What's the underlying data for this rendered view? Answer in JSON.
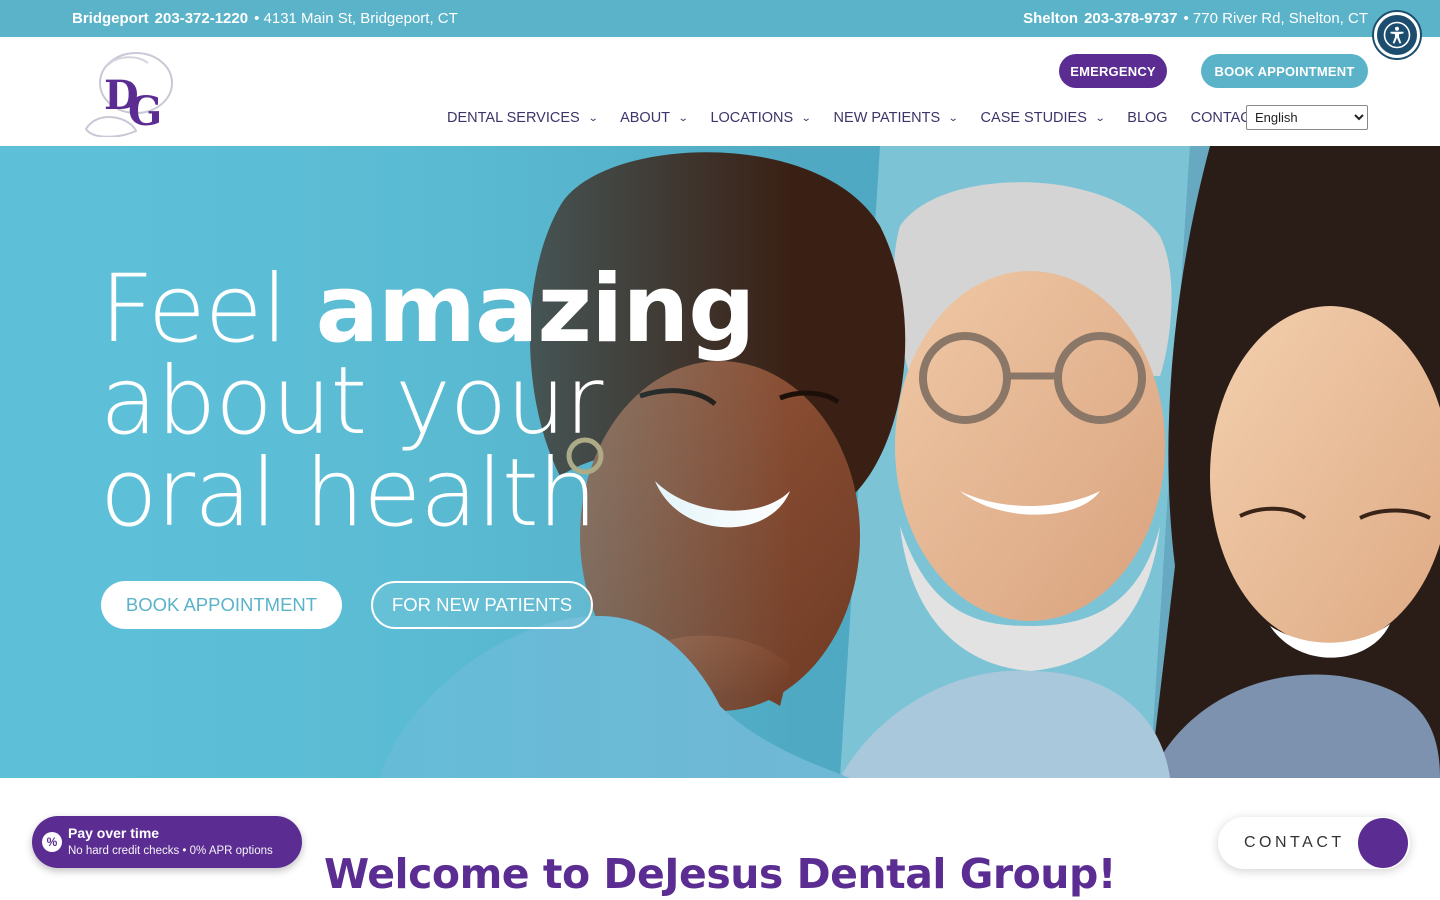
{
  "topbar": {
    "left": {
      "city": "Bridgeport",
      "phone": "203-372-1220",
      "address": "• 4131 Main St, Bridgeport, CT"
    },
    "right": {
      "city": "Shelton",
      "phone": "203-378-9737",
      "address": "• 770 River Rd, Shelton, CT"
    }
  },
  "accessibility": {
    "icon": "accessibility-icon"
  },
  "logo": {
    "text": "DG"
  },
  "header": {
    "emergency_label": "EMERGENCY",
    "book_label": "BOOK APPOINTMENT"
  },
  "nav": {
    "items": [
      {
        "label": "DENTAL SERVICES",
        "has_dropdown": true
      },
      {
        "label": "ABOUT",
        "has_dropdown": true
      },
      {
        "label": "LOCATIONS",
        "has_dropdown": true
      },
      {
        "label": "NEW PATIENTS",
        "has_dropdown": true
      },
      {
        "label": "CASE STUDIES",
        "has_dropdown": true
      },
      {
        "label": "BLOG",
        "has_dropdown": false
      },
      {
        "label": "CONTACT",
        "has_dropdown": false
      }
    ],
    "language": {
      "selected": "English"
    }
  },
  "hero": {
    "line1_light": "Feel",
    "line1_bold": "amazing",
    "line2": "about your",
    "line3": "oral health",
    "book_label": "BOOK APPOINTMENT",
    "new_patients_label": "FOR NEW PATIENTS"
  },
  "welcome": {
    "title": "Welcome to DeJesus Dental Group!"
  },
  "pay_badge": {
    "icon_glyph": "%",
    "title": "Pay over time",
    "subtitle": "No hard credit checks • 0% APR options"
  },
  "contact_float": {
    "label": "CONTACT"
  },
  "colors": {
    "teal": "#5bb3c9",
    "purple": "#5b2d92",
    "nav_text": "#3e3469",
    "white": "#ffffff"
  }
}
